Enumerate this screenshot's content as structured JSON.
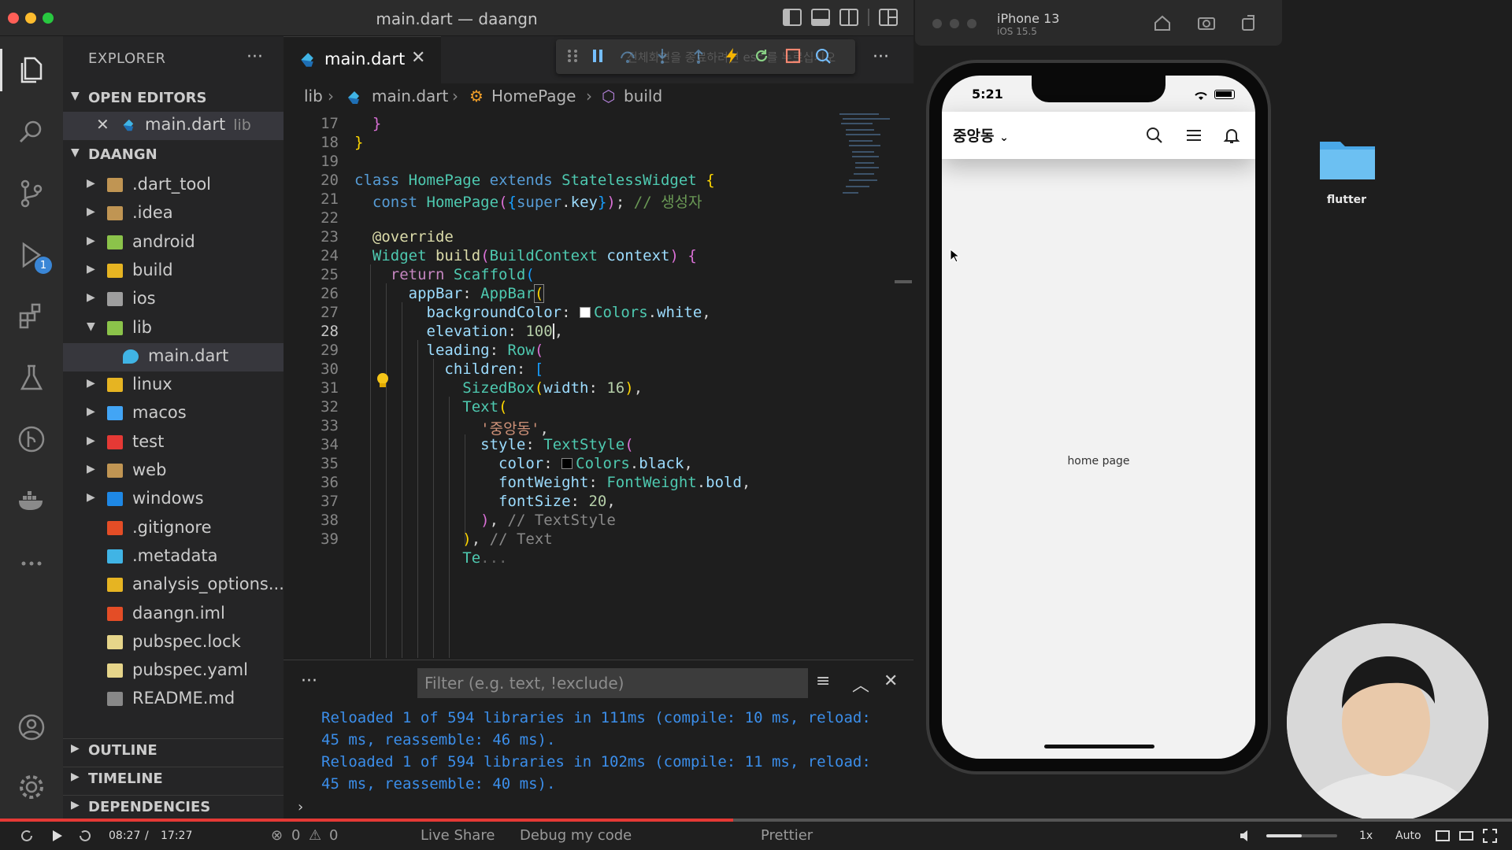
{
  "window": {
    "title": "main.dart — daangn"
  },
  "explorer": {
    "header": "EXPLORER",
    "open_editors_label": "OPEN EDITORS",
    "open_editor": {
      "name": "main.dart",
      "folder": "lib"
    },
    "project_label": "DAANGN",
    "tree": [
      {
        "name": ".dart_tool",
        "kind": "folder",
        "expanded": false
      },
      {
        "name": ".idea",
        "kind": "folder",
        "expanded": false
      },
      {
        "name": "android",
        "kind": "folder",
        "expanded": false
      },
      {
        "name": "build",
        "kind": "folder",
        "expanded": false
      },
      {
        "name": "ios",
        "kind": "folder",
        "expanded": false
      },
      {
        "name": "lib",
        "kind": "folder",
        "expanded": true
      },
      {
        "name": "main.dart",
        "kind": "file",
        "selected": true
      },
      {
        "name": "linux",
        "kind": "folder",
        "expanded": false
      },
      {
        "name": "macos",
        "kind": "folder",
        "expanded": false
      },
      {
        "name": "test",
        "kind": "folder",
        "expanded": false
      },
      {
        "name": "web",
        "kind": "folder",
        "expanded": false
      },
      {
        "name": "windows",
        "kind": "folder",
        "expanded": false
      },
      {
        "name": ".gitignore",
        "kind": "file"
      },
      {
        "name": ".metadata",
        "kind": "file"
      },
      {
        "name": "analysis_options....",
        "kind": "file"
      },
      {
        "name": "daangn.iml",
        "kind": "file"
      },
      {
        "name": "pubspec.lock",
        "kind": "file"
      },
      {
        "name": "pubspec.yaml",
        "kind": "file"
      },
      {
        "name": "README.md",
        "kind": "file"
      }
    ],
    "outline_label": "OUTLINE",
    "timeline_label": "TIMELINE",
    "dependencies_label": "DEPENDENCIES"
  },
  "activity": {
    "run_badge": "1"
  },
  "editor": {
    "tab": {
      "name": "main.dart"
    },
    "debug_hint": "전체화면을 종료하려면 esc 를 누르십시오",
    "breadcrumb": [
      "lib",
      "main.dart",
      "HomePage",
      "build"
    ],
    "line_numbers": [
      "17",
      "18",
      "19",
      "20",
      "21",
      "22",
      "23",
      "24",
      "25",
      "26",
      "27",
      "28",
      "29",
      "30",
      "31",
      "32",
      "33",
      "34",
      "35",
      "36",
      "37",
      "38",
      "39"
    ],
    "current_line": "28"
  },
  "panel": {
    "filter_placeholder": "Filter (e.g. text, !exclude)",
    "log": [
      "Reloaded 1 of 594 libraries in 111ms (compile: 10 ms, reload:",
      "45 ms, reassemble: 46 ms).",
      "Reloaded 1 of 594 libraries in 102ms (compile: 11 ms, reload:",
      "45 ms, reassemble: 40 ms)."
    ]
  },
  "simulator": {
    "device": "iPhone 13",
    "os": "iOS 15.5",
    "time": "5:21",
    "location": "중앙동",
    "body_text": "home page"
  },
  "desktop": {
    "folder_label": "flutter"
  },
  "player": {
    "current": "08:27",
    "separator": "/",
    "total": "17:27",
    "progress_fraction": 0.485,
    "volume_fraction": 0.5,
    "speed": "1x",
    "quality": "Auto",
    "statusbar": {
      "errors": "0",
      "warnings": "0",
      "live_share": "Live Share",
      "debug": "Debug my code",
      "prettier": "Prettier"
    }
  },
  "colors": {
    "accent": "#3a86d6",
    "progress": "#e53935",
    "log_text": "#3b8eea"
  }
}
